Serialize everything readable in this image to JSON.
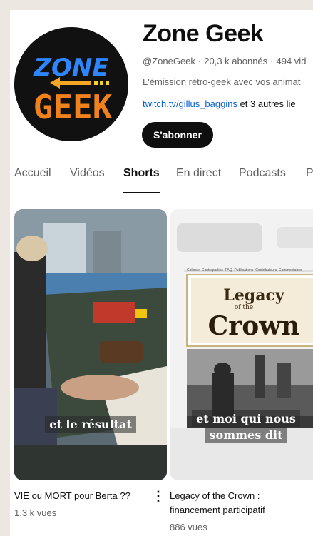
{
  "channel": {
    "name": "Zone Geek",
    "handle": "@ZoneGeek",
    "subscribers": "20,3 k abonnés",
    "videos": "494 vid",
    "description": "L'émission rétro-geek avec vos animat",
    "link": "twitch.tv/gillus_baggins",
    "other_links": " et 3 autres lie",
    "subscribe_label": "S'abonner",
    "logo_top": "ZONE",
    "logo_bottom": "GEEK"
  },
  "tabs": [
    "Accueil",
    "Vidéos",
    "Shorts",
    "En direct",
    "Podcasts",
    "P"
  ],
  "active_tab": "Shorts",
  "shorts": [
    {
      "title": "VIE ou MORT pour Berta ??",
      "views": "1,3 k vues",
      "overlay": "et le résultat"
    },
    {
      "title_line1": "Legacy of the Crown :",
      "title_line2": "financement participatif",
      "views": "886 vues",
      "overlay_line1": "et moi qui nous",
      "overlay_line2": "sommes dit",
      "poster_title_1": "Legacy",
      "poster_title_2": "Crown",
      "poster_of": "of the",
      "menu_items": [
        "Collecte",
        "Contreparties",
        "FAQ",
        "Publications",
        "Contributeurs",
        "Commentaires"
      ]
    }
  ]
}
